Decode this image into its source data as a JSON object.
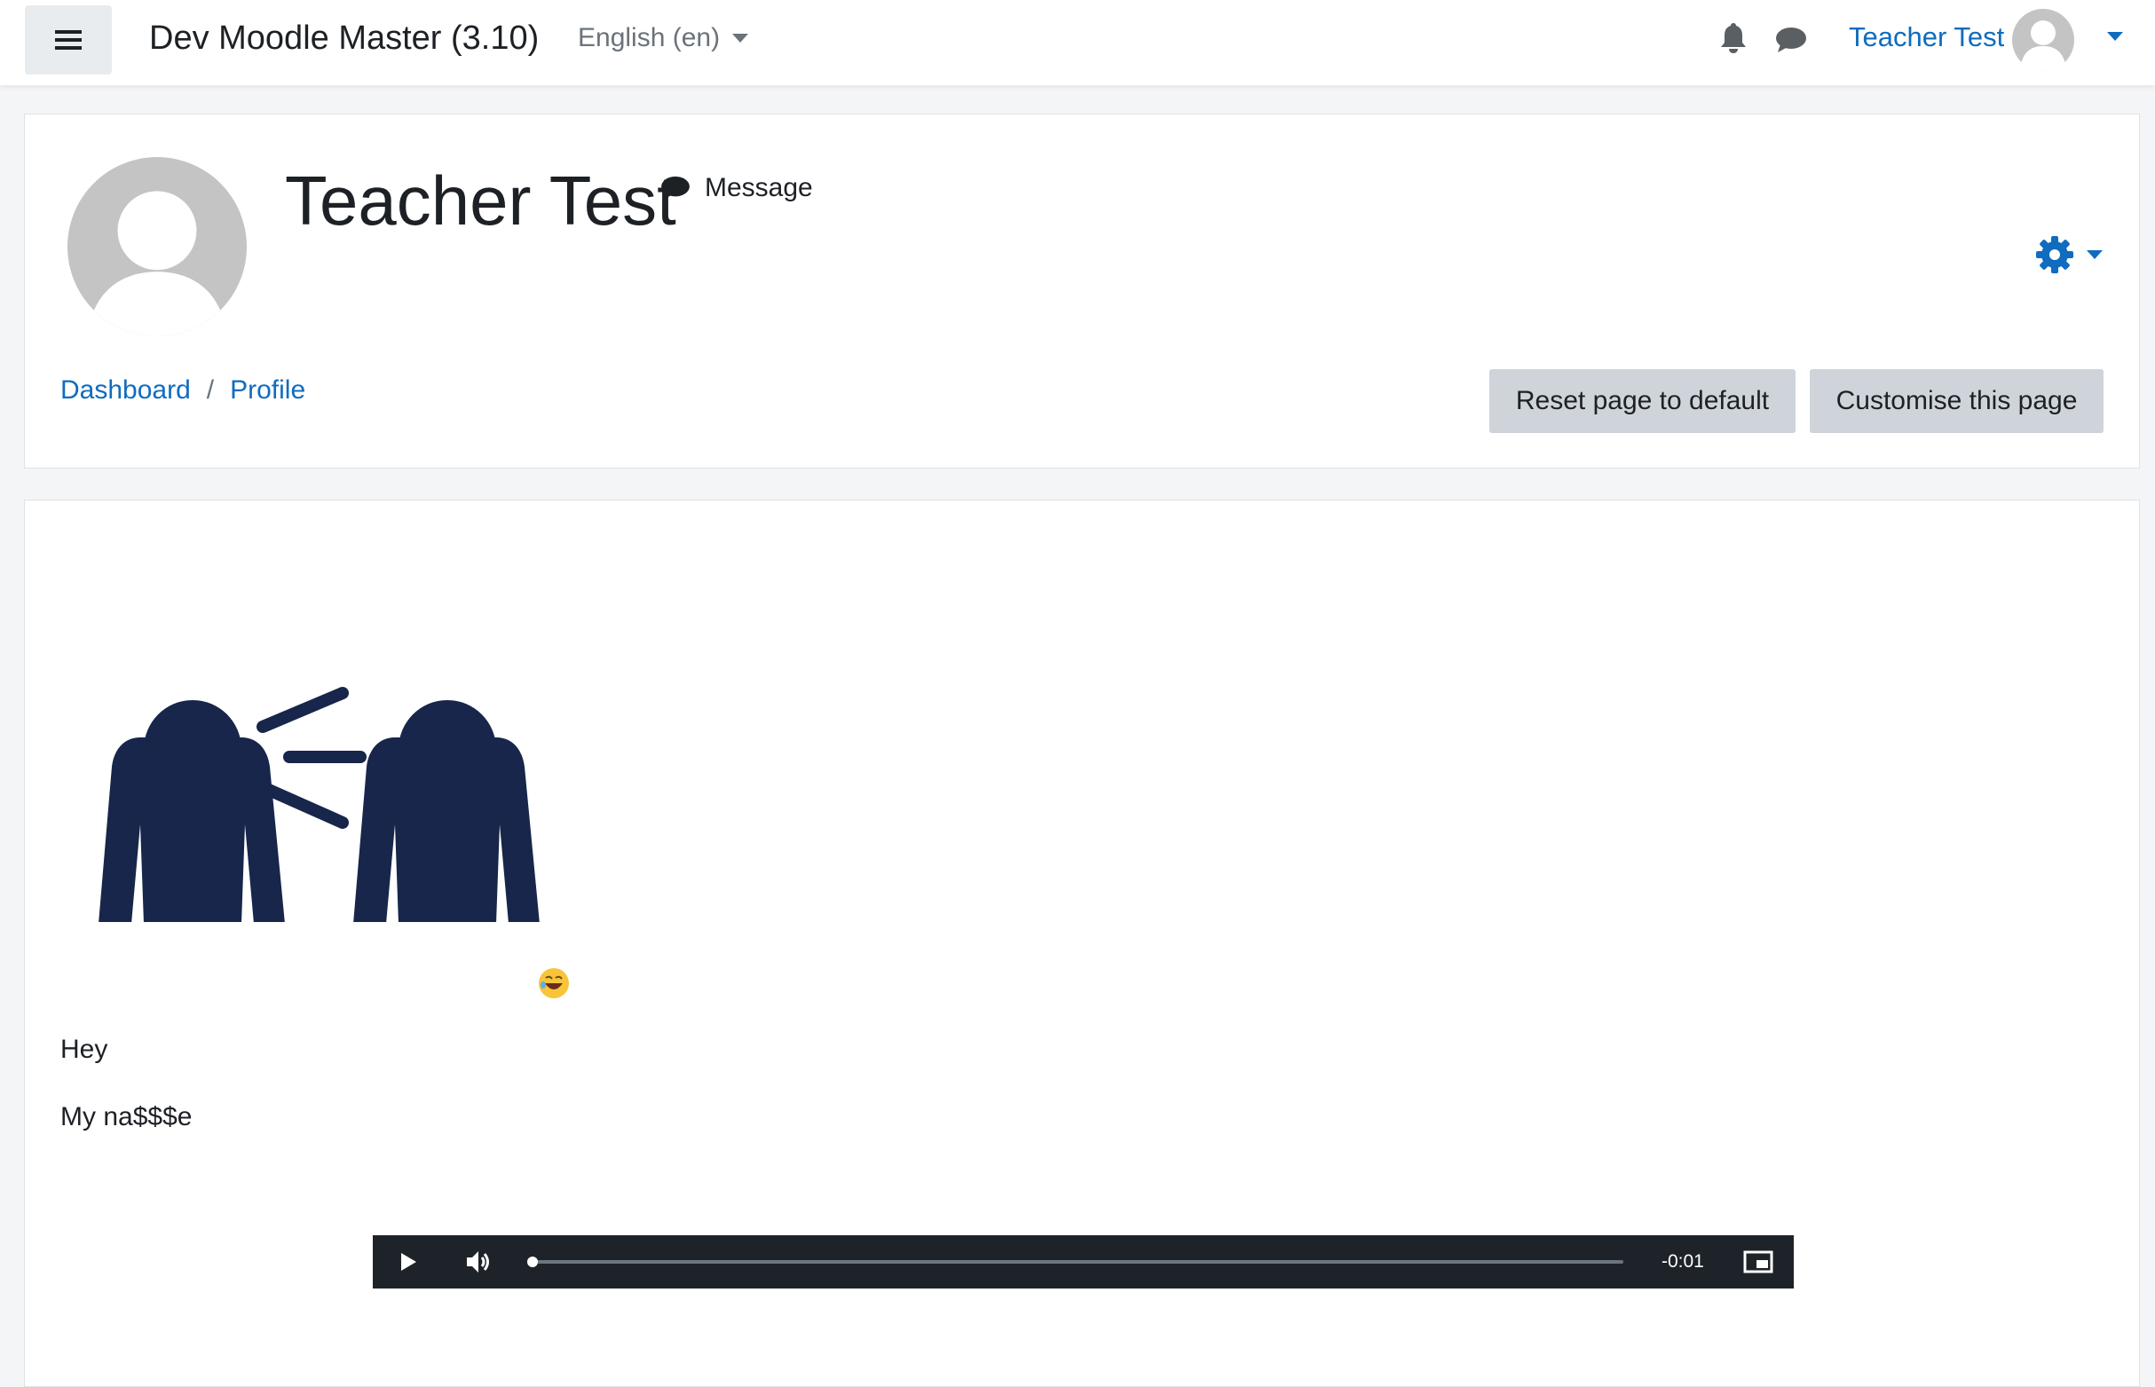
{
  "navbar": {
    "site_name": "Dev Moodle Master (3.10)",
    "language": "English (en)",
    "user_name": "Teacher Test",
    "icons": [
      "hamburger-icon",
      "bell-icon",
      "chat-icon",
      "avatar",
      "chevron-down-icon"
    ]
  },
  "profile": {
    "name": "Teacher Test",
    "message_label": "Message"
  },
  "breadcrumb": {
    "items": [
      "Dashboard",
      "Profile"
    ],
    "separator": "/"
  },
  "buttons": {
    "reset": "Reset page to default",
    "customise": "Customise this page"
  },
  "content": {
    "line1": "Hey",
    "line2": "My na$$$e"
  },
  "player": {
    "time": "-0:01",
    "progress_percent": 0
  },
  "colors": {
    "link": "#0f6cbf",
    "illustration": "#17264a",
    "player_bg": "#1d2329",
    "button_bg": "#ced4da"
  }
}
